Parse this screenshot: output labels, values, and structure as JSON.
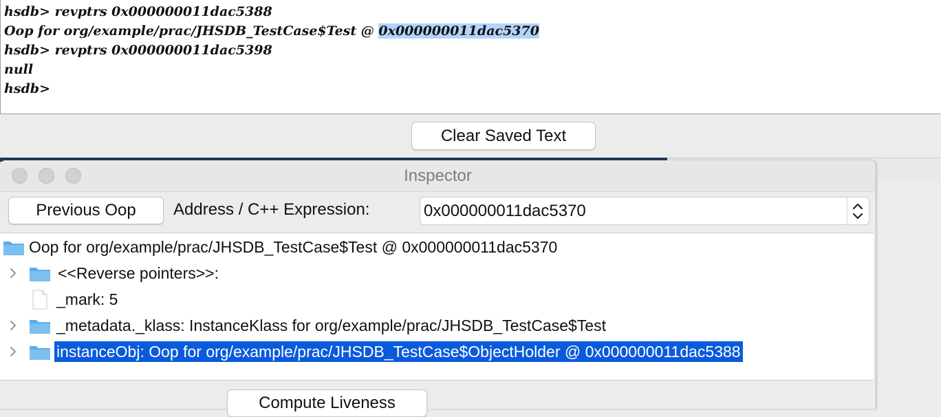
{
  "console": {
    "lines": [
      {
        "text": "hsdb> revptrs 0x000000011dac5388"
      },
      {
        "prefix": "Oop for org/example/prac/JHSDB_TestCase$Test @ ",
        "highlighted": "0x000000011dac5370"
      },
      {
        "text": "hsdb> revptrs 0x000000011dac5398"
      },
      {
        "text": "null"
      },
      {
        "text": "hsdb>"
      }
    ],
    "clear_button": "Clear Saved Text"
  },
  "inspector": {
    "title": "Inspector",
    "previous_oop_button": "Previous Oop",
    "address_label": "Address / C++ Expression:",
    "address_value": "0x000000011dac5370",
    "tree": {
      "root": {
        "label": "Oop for org/example/prac/JHSDB_TestCase$Test @ 0x000000011dac5370",
        "icon": "folder-icon"
      },
      "children": [
        {
          "label": "<<Reverse pointers>>:",
          "icon": "folder-icon",
          "expandable": true
        },
        {
          "label": "_mark: 5",
          "icon": "file-icon",
          "expandable": false
        },
        {
          "label": "_metadata._klass: InstanceKlass for org/example/prac/JHSDB_TestCase$Test",
          "icon": "folder-icon",
          "expandable": true
        },
        {
          "label": "instanceObj: Oop for org/example/prac/JHSDB_TestCase$ObjectHolder @ 0x000000011dac5388",
          "icon": "folder-icon",
          "expandable": true,
          "selected": true
        }
      ]
    },
    "compute_liveness_button": "Compute Liveness"
  },
  "colors": {
    "selection": "#0a5bdc",
    "text_highlight": "#b3d4fc",
    "folder": "#5aaee8",
    "background_window": "#23395a"
  }
}
